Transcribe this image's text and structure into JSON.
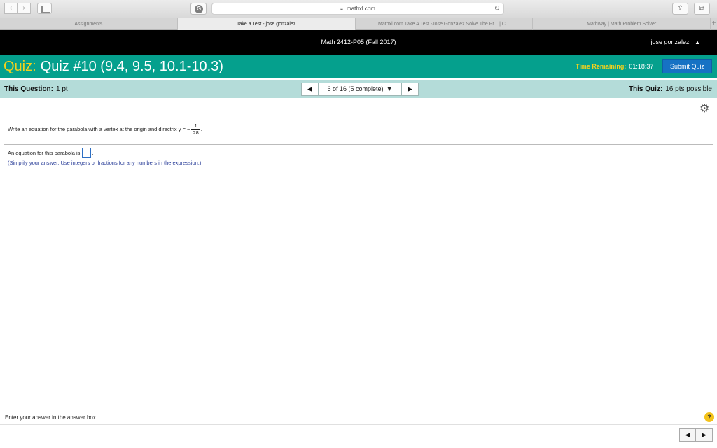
{
  "browser": {
    "url": "mathxl.com",
    "tabs": [
      {
        "label": "Assignments",
        "active": false
      },
      {
        "label": "Take a Test - jose gonzalez",
        "active": true
      },
      {
        "label": "Mathxl.com Take A Test -Jose Gonzalez Solve The Pr... | C...",
        "active": false
      },
      {
        "label": "Mathway | Math Problem Solver",
        "active": false
      }
    ],
    "new_tab_label": "+",
    "reader_label": "G"
  },
  "course": {
    "title": "Math 2412-P05 (Fall 2017)",
    "user": "jose gonzalez"
  },
  "quiz": {
    "prefix": "Quiz:",
    "name": "Quiz #10 (9.4, 9.5, 10.1-10.3)",
    "time_label": "Time Remaining:",
    "time_value": "01:18:37",
    "submit_label": "Submit Quiz"
  },
  "question_bar": {
    "this_question_label": "This Question:",
    "this_question_value": "1 pt",
    "pager_text": "6 of 16 (5 complete)",
    "this_quiz_label": "This Quiz:",
    "this_quiz_value": "16 pts possible"
  },
  "question": {
    "prompt": "Write an equation for the parabola with a vertex at the origin and directrix y = −",
    "frac_num": "1",
    "frac_den": "28",
    "prompt_end": ".",
    "answer_prefix": "An equation for this parabola  is",
    "answer_suffix": ".",
    "hint": "(Simplify your answer. Use integers or fractions for any numbers in the expression.)"
  },
  "footer": {
    "instruction": "Enter your answer in the answer box.",
    "help_label": "?"
  },
  "colors": {
    "quiz_bar": "#05a08d",
    "quiz_prefix": "#f4d21c",
    "question_bar": "#b4dcd9",
    "submit": "#1672c4",
    "hint": "#2b3f99"
  }
}
